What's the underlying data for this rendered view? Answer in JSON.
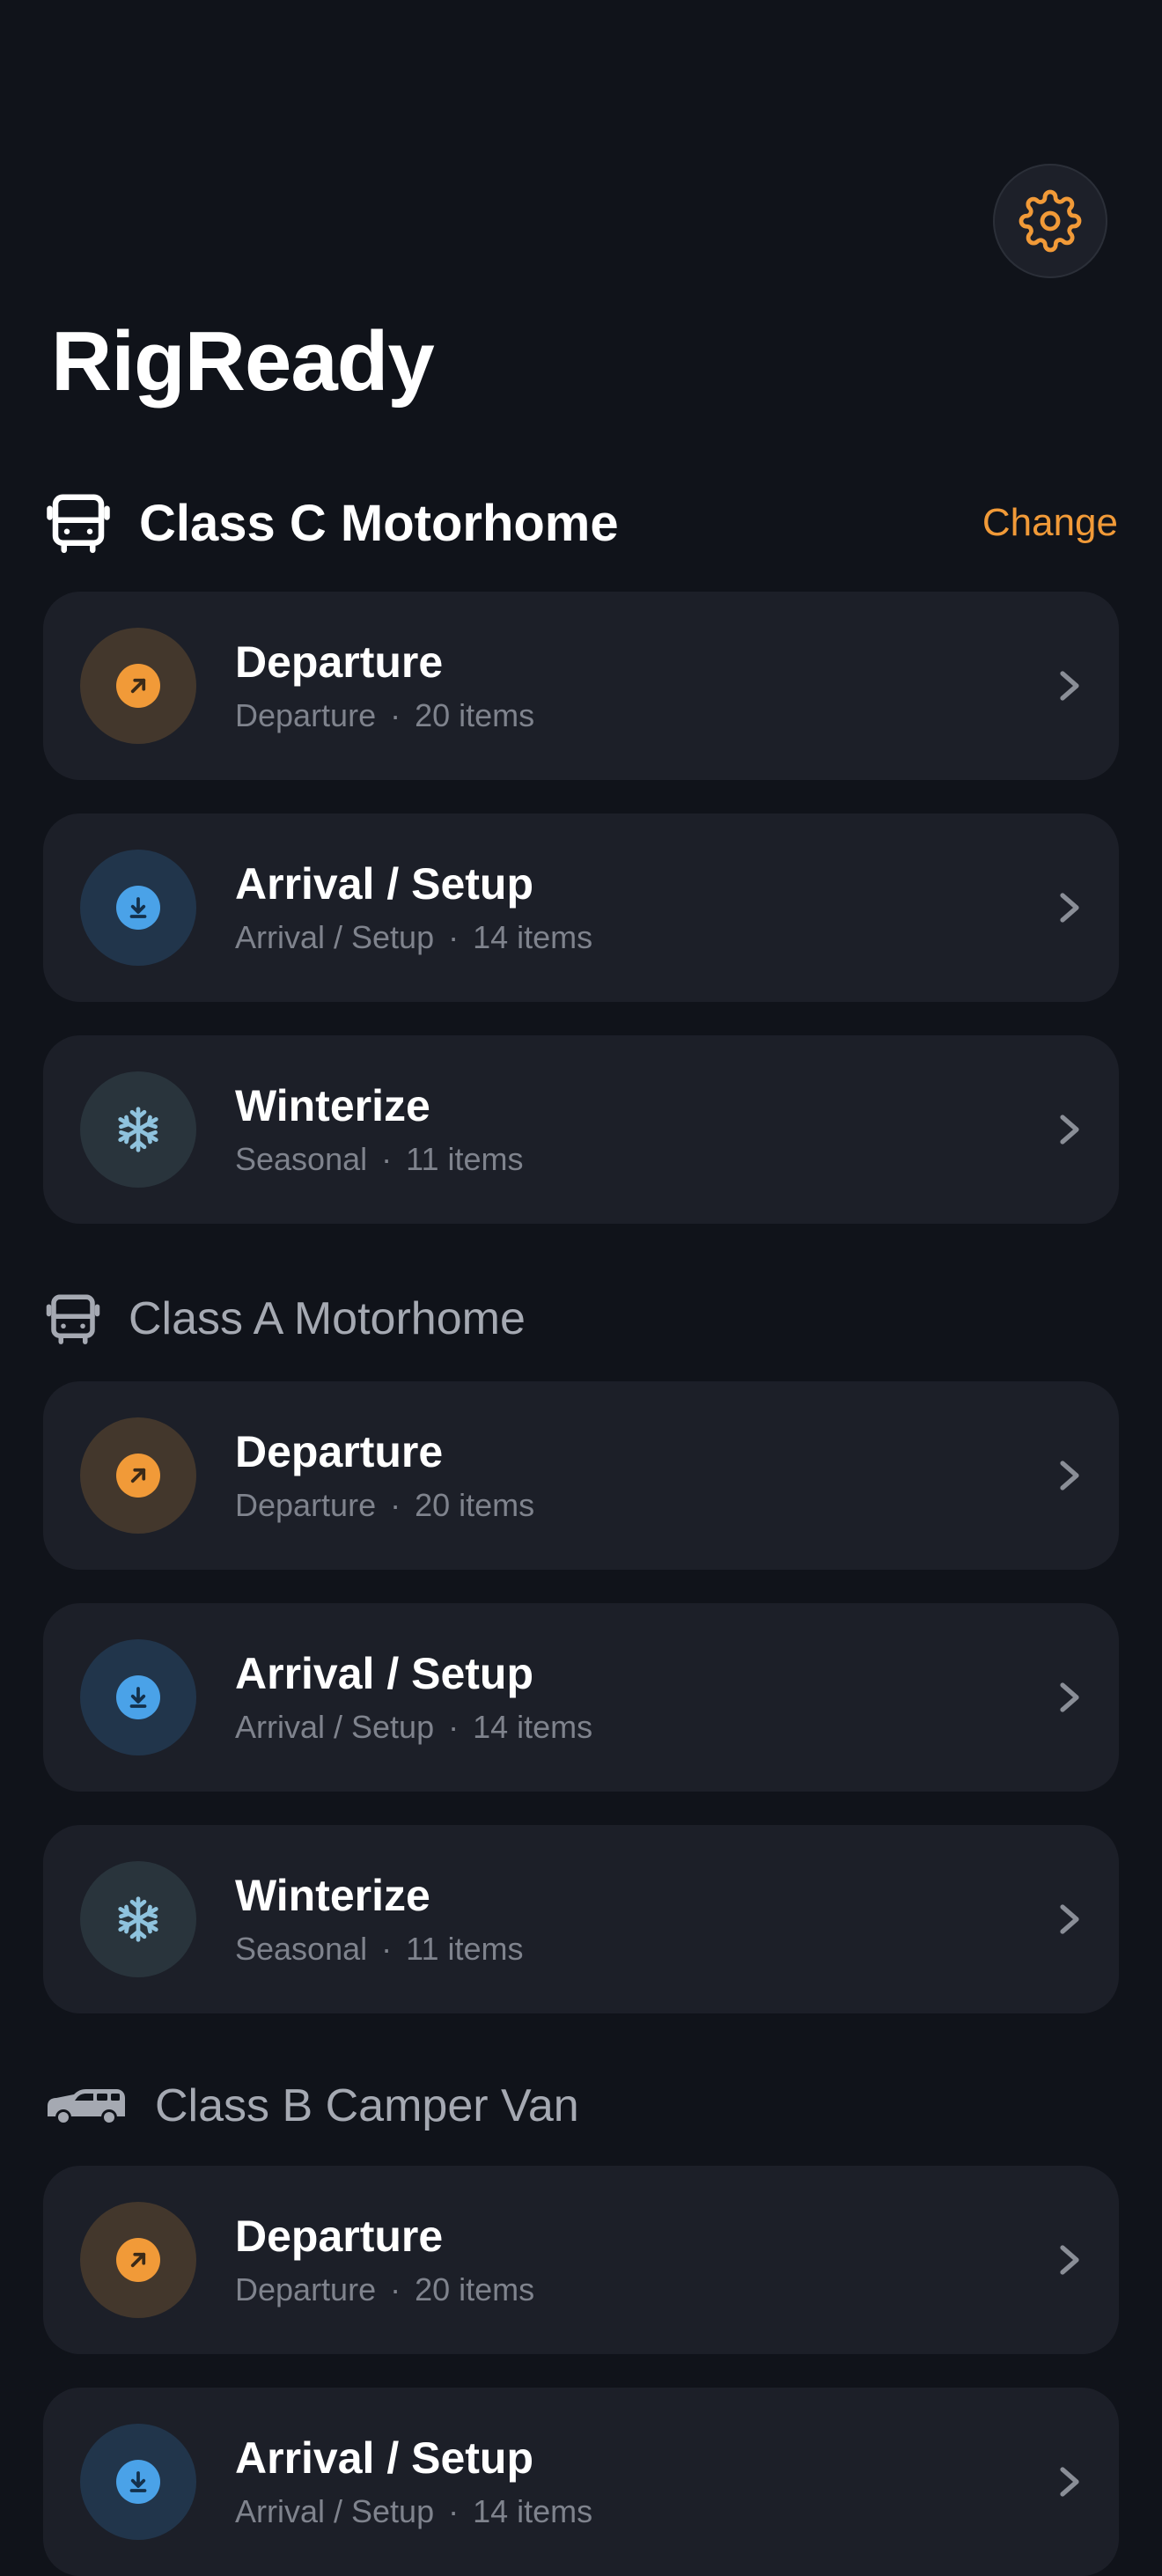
{
  "app": {
    "title": "RigReady",
    "settings_icon": "gear-icon"
  },
  "colors": {
    "background": "#10131a",
    "card": "#1c1f28",
    "accent": "#f19a38",
    "arrival_blue": "#4aa2e8",
    "winter_blue": "#8fc3de",
    "muted_text": "#7f838d"
  },
  "sections": [
    {
      "title": "Class C Motorhome",
      "icon": "bus-icon",
      "action_label": "Change",
      "cards": [
        {
          "title": "Departure",
          "category": "Departure",
          "separator": "·",
          "count": "20 items",
          "icon": "arrow-up-right-icon"
        },
        {
          "title": "Arrival / Setup",
          "category": "Arrival / Setup",
          "separator": "·",
          "count": "14 items",
          "icon": "download-icon"
        },
        {
          "title": "Winterize",
          "category": "Seasonal",
          "separator": "·",
          "count": "11 items",
          "icon": "snowflake-icon"
        }
      ]
    },
    {
      "title": "Class A Motorhome",
      "icon": "bus-icon",
      "cards": [
        {
          "title": "Departure",
          "category": "Departure",
          "separator": "·",
          "count": "20 items",
          "icon": "arrow-up-right-icon"
        },
        {
          "title": "Arrival / Setup",
          "category": "Arrival / Setup",
          "separator": "·",
          "count": "14 items",
          "icon": "download-icon"
        },
        {
          "title": "Winterize",
          "category": "Seasonal",
          "separator": "·",
          "count": "11 items",
          "icon": "snowflake-icon"
        }
      ]
    },
    {
      "title": "Class B Camper Van",
      "icon": "van-icon",
      "cards": [
        {
          "title": "Departure",
          "category": "Departure",
          "separator": "·",
          "count": "20 items",
          "icon": "arrow-up-right-icon"
        },
        {
          "title": "Arrival / Setup",
          "category": "Arrival / Setup",
          "separator": "·",
          "count": "14 items",
          "icon": "download-icon"
        }
      ]
    }
  ]
}
